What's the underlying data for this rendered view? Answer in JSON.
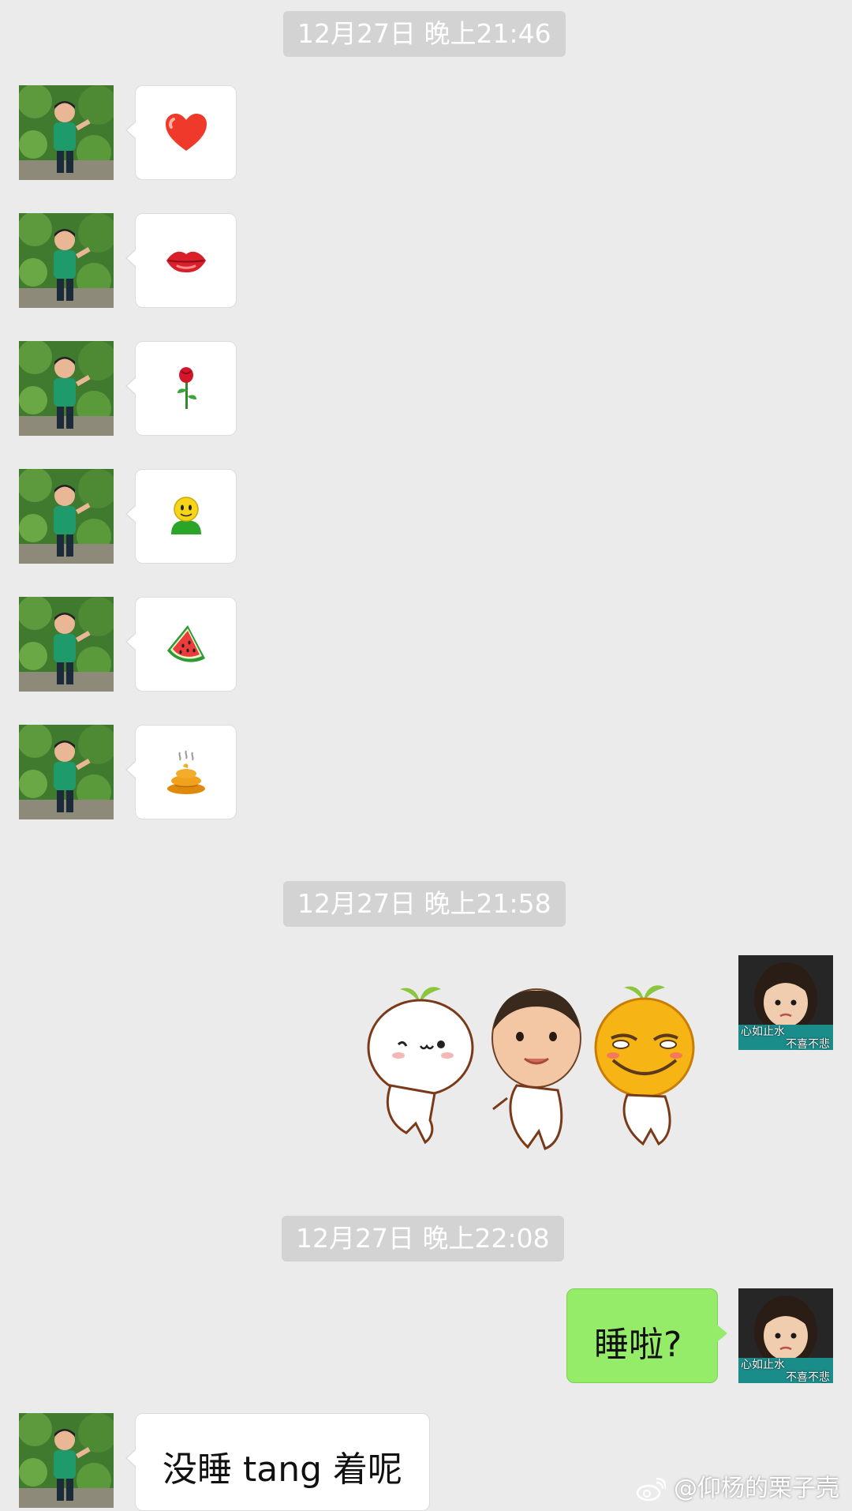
{
  "conversation": {
    "timestamps": [
      "12月27日 晚上21:46",
      "12月27日 晚上21:58",
      "12月27日 晚上22:08"
    ],
    "emoji_messages": [
      {
        "icon": "heart-icon"
      },
      {
        "icon": "lips-icon"
      },
      {
        "icon": "rose-icon"
      },
      {
        "icon": "smiley-person-icon"
      },
      {
        "icon": "watermelon-icon"
      },
      {
        "icon": "poop-icon"
      }
    ],
    "sticker_message": {
      "icon": "sticker-group"
    },
    "my_text": "睡啦?",
    "reply_text": "没睡 tang 着呢"
  },
  "avatars": {
    "me_caption_1": "心如止水",
    "me_caption_2": "不喜不悲"
  },
  "watermark": {
    "text": "@仰杨的栗子壳"
  },
  "colors": {
    "background": "#ebebeb",
    "timestamp_bg": "#d3d3d3",
    "my_bubble": "#95ec69",
    "their_bubble": "#ffffff"
  }
}
